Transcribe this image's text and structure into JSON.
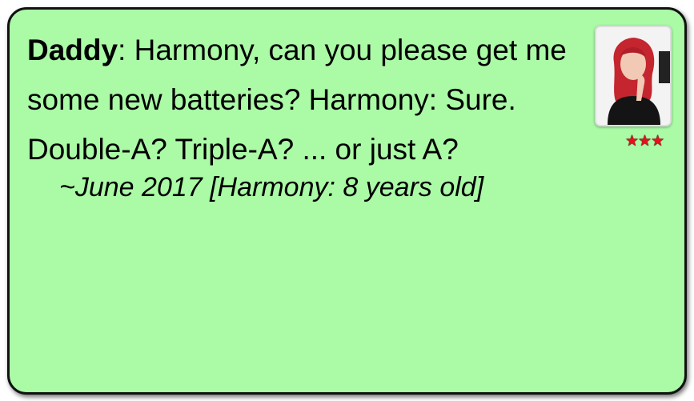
{
  "quote": {
    "speaker": "Daddy",
    "text": ": Harmony, can you please get me some new batteries? Harmony: Sure. Double-A? Triple-A? ... or just A?",
    "dateline": "~June 2017 [Harmony: 8 years old]"
  },
  "rating": {
    "stars_display": "★★★",
    "value": 3,
    "max": 3
  },
  "colors": {
    "card_background": "#aafaa6",
    "card_border": "#111111",
    "star": "#e8101c"
  },
  "icons": {
    "avatar": "photo-of-girl-with-red-hair",
    "rating": "star-icon"
  }
}
